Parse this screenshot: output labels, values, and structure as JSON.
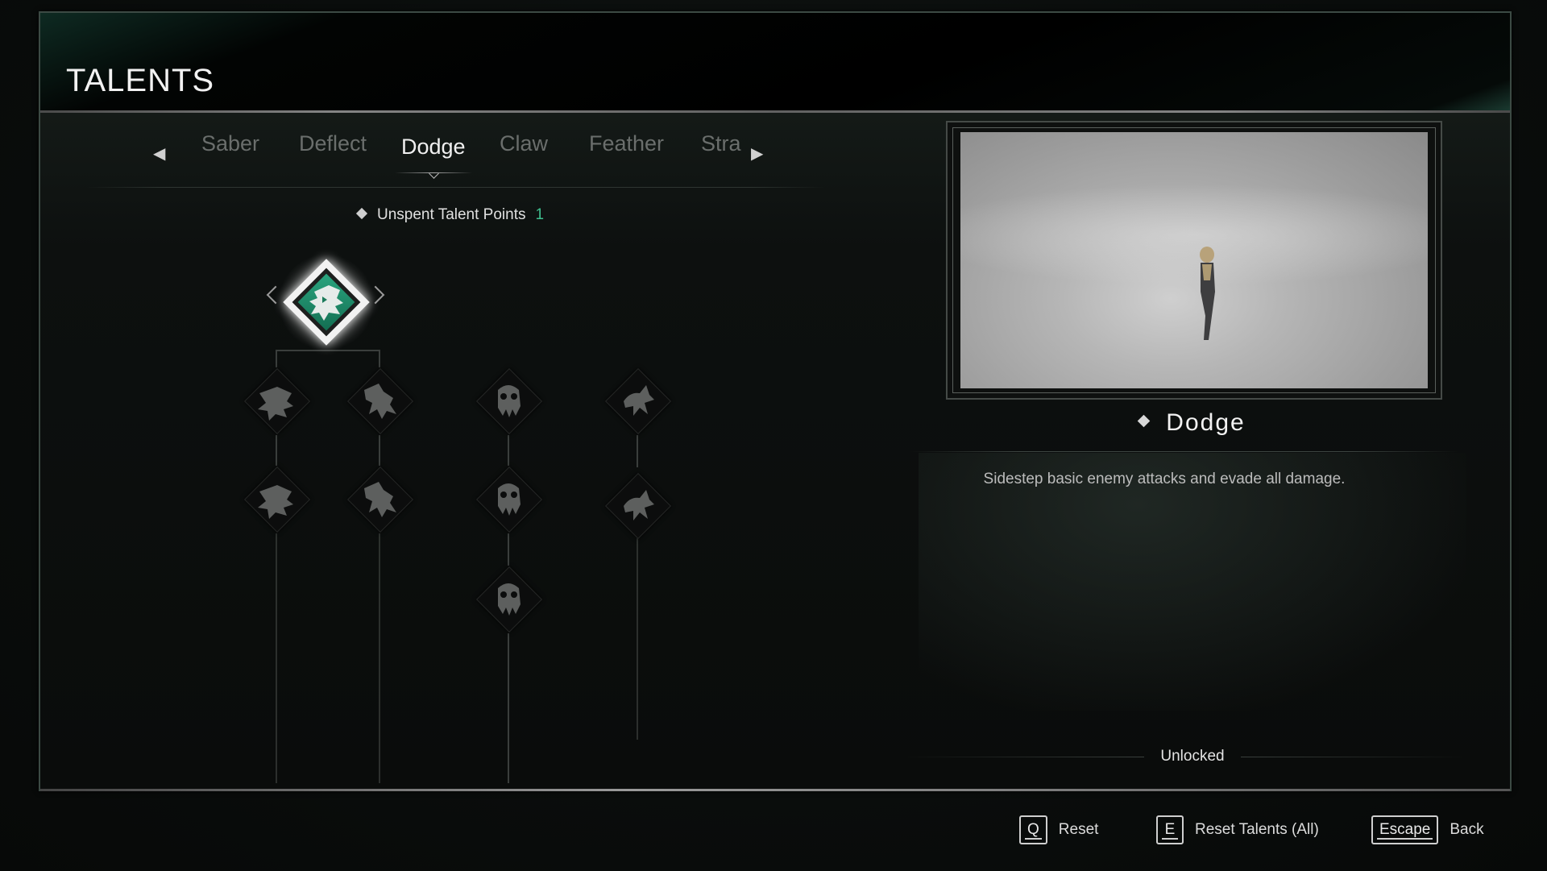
{
  "header": {
    "title": "TALENTS"
  },
  "tabs": {
    "items": [
      {
        "label": "Saber",
        "active": false
      },
      {
        "label": "Deflect",
        "active": false
      },
      {
        "label": "Dodge",
        "active": true
      },
      {
        "label": "Claw",
        "active": false
      },
      {
        "label": "Feather",
        "active": false
      },
      {
        "label": "Stra",
        "active": false
      }
    ],
    "prev_icon": "chevron-left-icon",
    "next_icon": "chevron-right-icon"
  },
  "talent_points": {
    "label": "Unspent Talent Points",
    "count": "1",
    "accent_color": "#3fbf8f"
  },
  "tree": {
    "root": {
      "name": "Dodge",
      "state": "unlocked",
      "icon": "beast-head-icon"
    },
    "branches": [
      {
        "nodes": [
          {
            "state": "locked",
            "icon": "beast-head-icon"
          },
          {
            "state": "locked",
            "icon": "beast-head-icon"
          }
        ]
      },
      {
        "nodes": [
          {
            "state": "locked",
            "icon": "crouching-figure-icon"
          },
          {
            "state": "locked",
            "icon": "crouching-figure-icon"
          }
        ]
      },
      {
        "nodes": [
          {
            "state": "locked",
            "icon": "skull-mask-icon"
          },
          {
            "state": "locked",
            "icon": "skull-mask-icon"
          },
          {
            "state": "locked",
            "icon": "skull-mask-icon"
          }
        ]
      },
      {
        "nodes": [
          {
            "state": "locked",
            "icon": "leaping-figure-icon"
          },
          {
            "state": "locked",
            "icon": "leaping-figure-icon"
          }
        ]
      }
    ]
  },
  "detail": {
    "title": "Dodge",
    "description": "Sidestep basic enemy attacks and evade all damage.",
    "status": "Unlocked",
    "preview": "dodge-preview-image"
  },
  "footer": {
    "hints": [
      {
        "key": "Q",
        "label": "Reset"
      },
      {
        "key": "E",
        "label": "Reset Talents (All)"
      },
      {
        "key": "Escape",
        "label": "Back"
      }
    ]
  }
}
